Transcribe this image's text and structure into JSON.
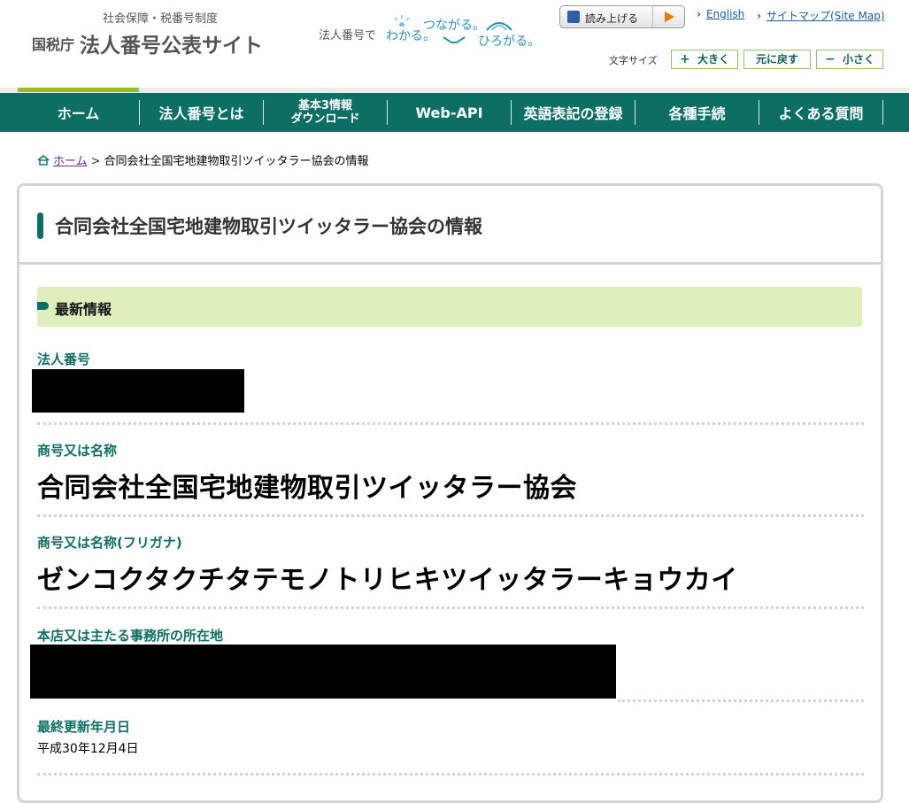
{
  "header": {
    "logo_sub": "社会保障・税番号制度",
    "logo_agency": "国税庁",
    "logo_title": "法人番号公表サイト",
    "tagline_lead": "法人番号で",
    "tagline_a": "わかる。",
    "tagline_b": "つながる。",
    "tagline_c": "ひろがる。",
    "read_aloud": "読み上げる",
    "english": "English",
    "sitemap": "サイトマップ(Site Map)",
    "font_size_label": "文字サイズ",
    "font_larger": "大きく",
    "font_reset": "元に戻す",
    "font_smaller": "小さく",
    "font_larger_symbol": "+",
    "font_smaller_symbol": "−"
  },
  "nav": {
    "items": [
      {
        "label": "ホーム"
      },
      {
        "label": "法人番号とは"
      },
      {
        "label": "基本3情報\nダウンロード"
      },
      {
        "label": "Web-API"
      },
      {
        "label": "英語表記の登録"
      },
      {
        "label": "各種手続"
      },
      {
        "label": "よくある質問"
      }
    ],
    "active_index": 0
  },
  "breadcrumb": {
    "home": "ホーム",
    "separator": ">",
    "current": "合同会社全国宅地建物取引ツイッタラー協会の情報"
  },
  "card": {
    "title": "合同会社全国宅地建物取引ツイッタラー協会の情報",
    "section_title": "最新情報",
    "fields": {
      "corp_number_label": "法人番号",
      "name_label": "商号又は名称",
      "name_value": "合同会社全国宅地建物取引ツイッタラー協会",
      "kana_label": "商号又は名称(フリガナ)",
      "kana_value": "ゼンコクタクチタテモノトリヒキツイッタラーキョウカイ",
      "address_label": "本店又は主たる事務所の所在地",
      "updated_label": "最終更新年月日",
      "updated_value": "平成30年12月4日"
    }
  },
  "colors": {
    "brand_green": "#0d6f63",
    "accent_lime": "#8dc21f",
    "section_bg": "#deeebc",
    "link_blue": "#1a5e9c",
    "visited_purple": "#6a2d91"
  }
}
